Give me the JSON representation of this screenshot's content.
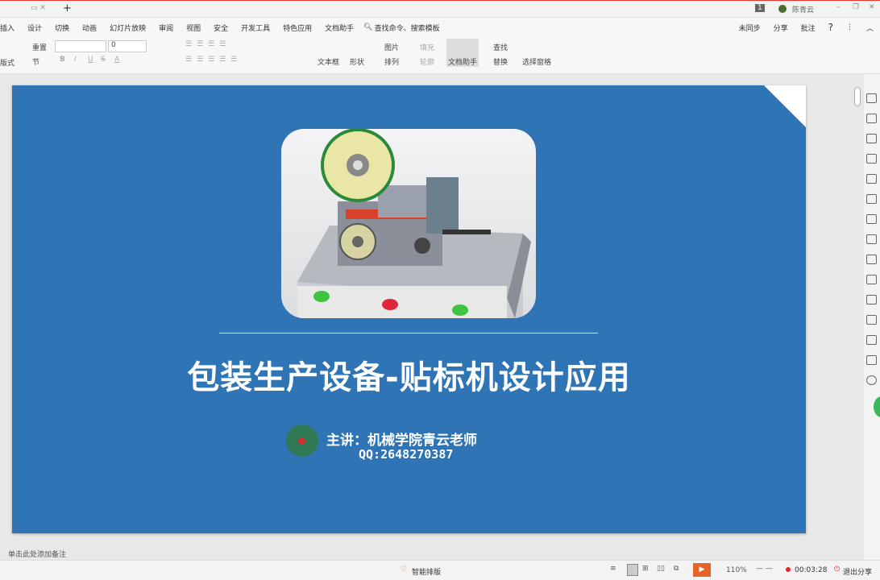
{
  "tabbar": {
    "new_tab": "+",
    "badge": "1",
    "user": "陈青云"
  },
  "menu": [
    "插入",
    "设计",
    "切换",
    "动画",
    "幻灯片放映",
    "审阅",
    "视图",
    "安全",
    "开发工具",
    "特色应用",
    "文档助手"
  ],
  "search": "查找命令、搜索模板",
  "right_menu": {
    "sync": "未同步",
    "share": "分享",
    "comment": "批注",
    "help": "?"
  },
  "toolbar": {
    "reset": "重置",
    "layout": "版式",
    "section": "节",
    "font_size": "0",
    "bold": "B",
    "italic": "I",
    "underline": "U",
    "strike": "S",
    "font_color": "A",
    "textbox": "文本框",
    "shape": "形状",
    "picture": "图片",
    "fill": "填充",
    "arrange": "排列",
    "outline": "轮廓",
    "doc_assistant": "文档助手",
    "find": "查找",
    "replace": "替换",
    "select_pane": "选择窗格"
  },
  "slide": {
    "title": "包装生产设备-贴标机设计应用",
    "speaker": "主讲：机械学院青云老师",
    "qq": "QQ:2648270387"
  },
  "status": {
    "notes": "单击此处添加备注",
    "smart_layout": "智能排版",
    "zoom": "110%",
    "timer": "00:03:28",
    "exit_share": "退出分享"
  },
  "colors": {
    "slide_bg": "#2f74b5",
    "accent": "#e8632a"
  }
}
